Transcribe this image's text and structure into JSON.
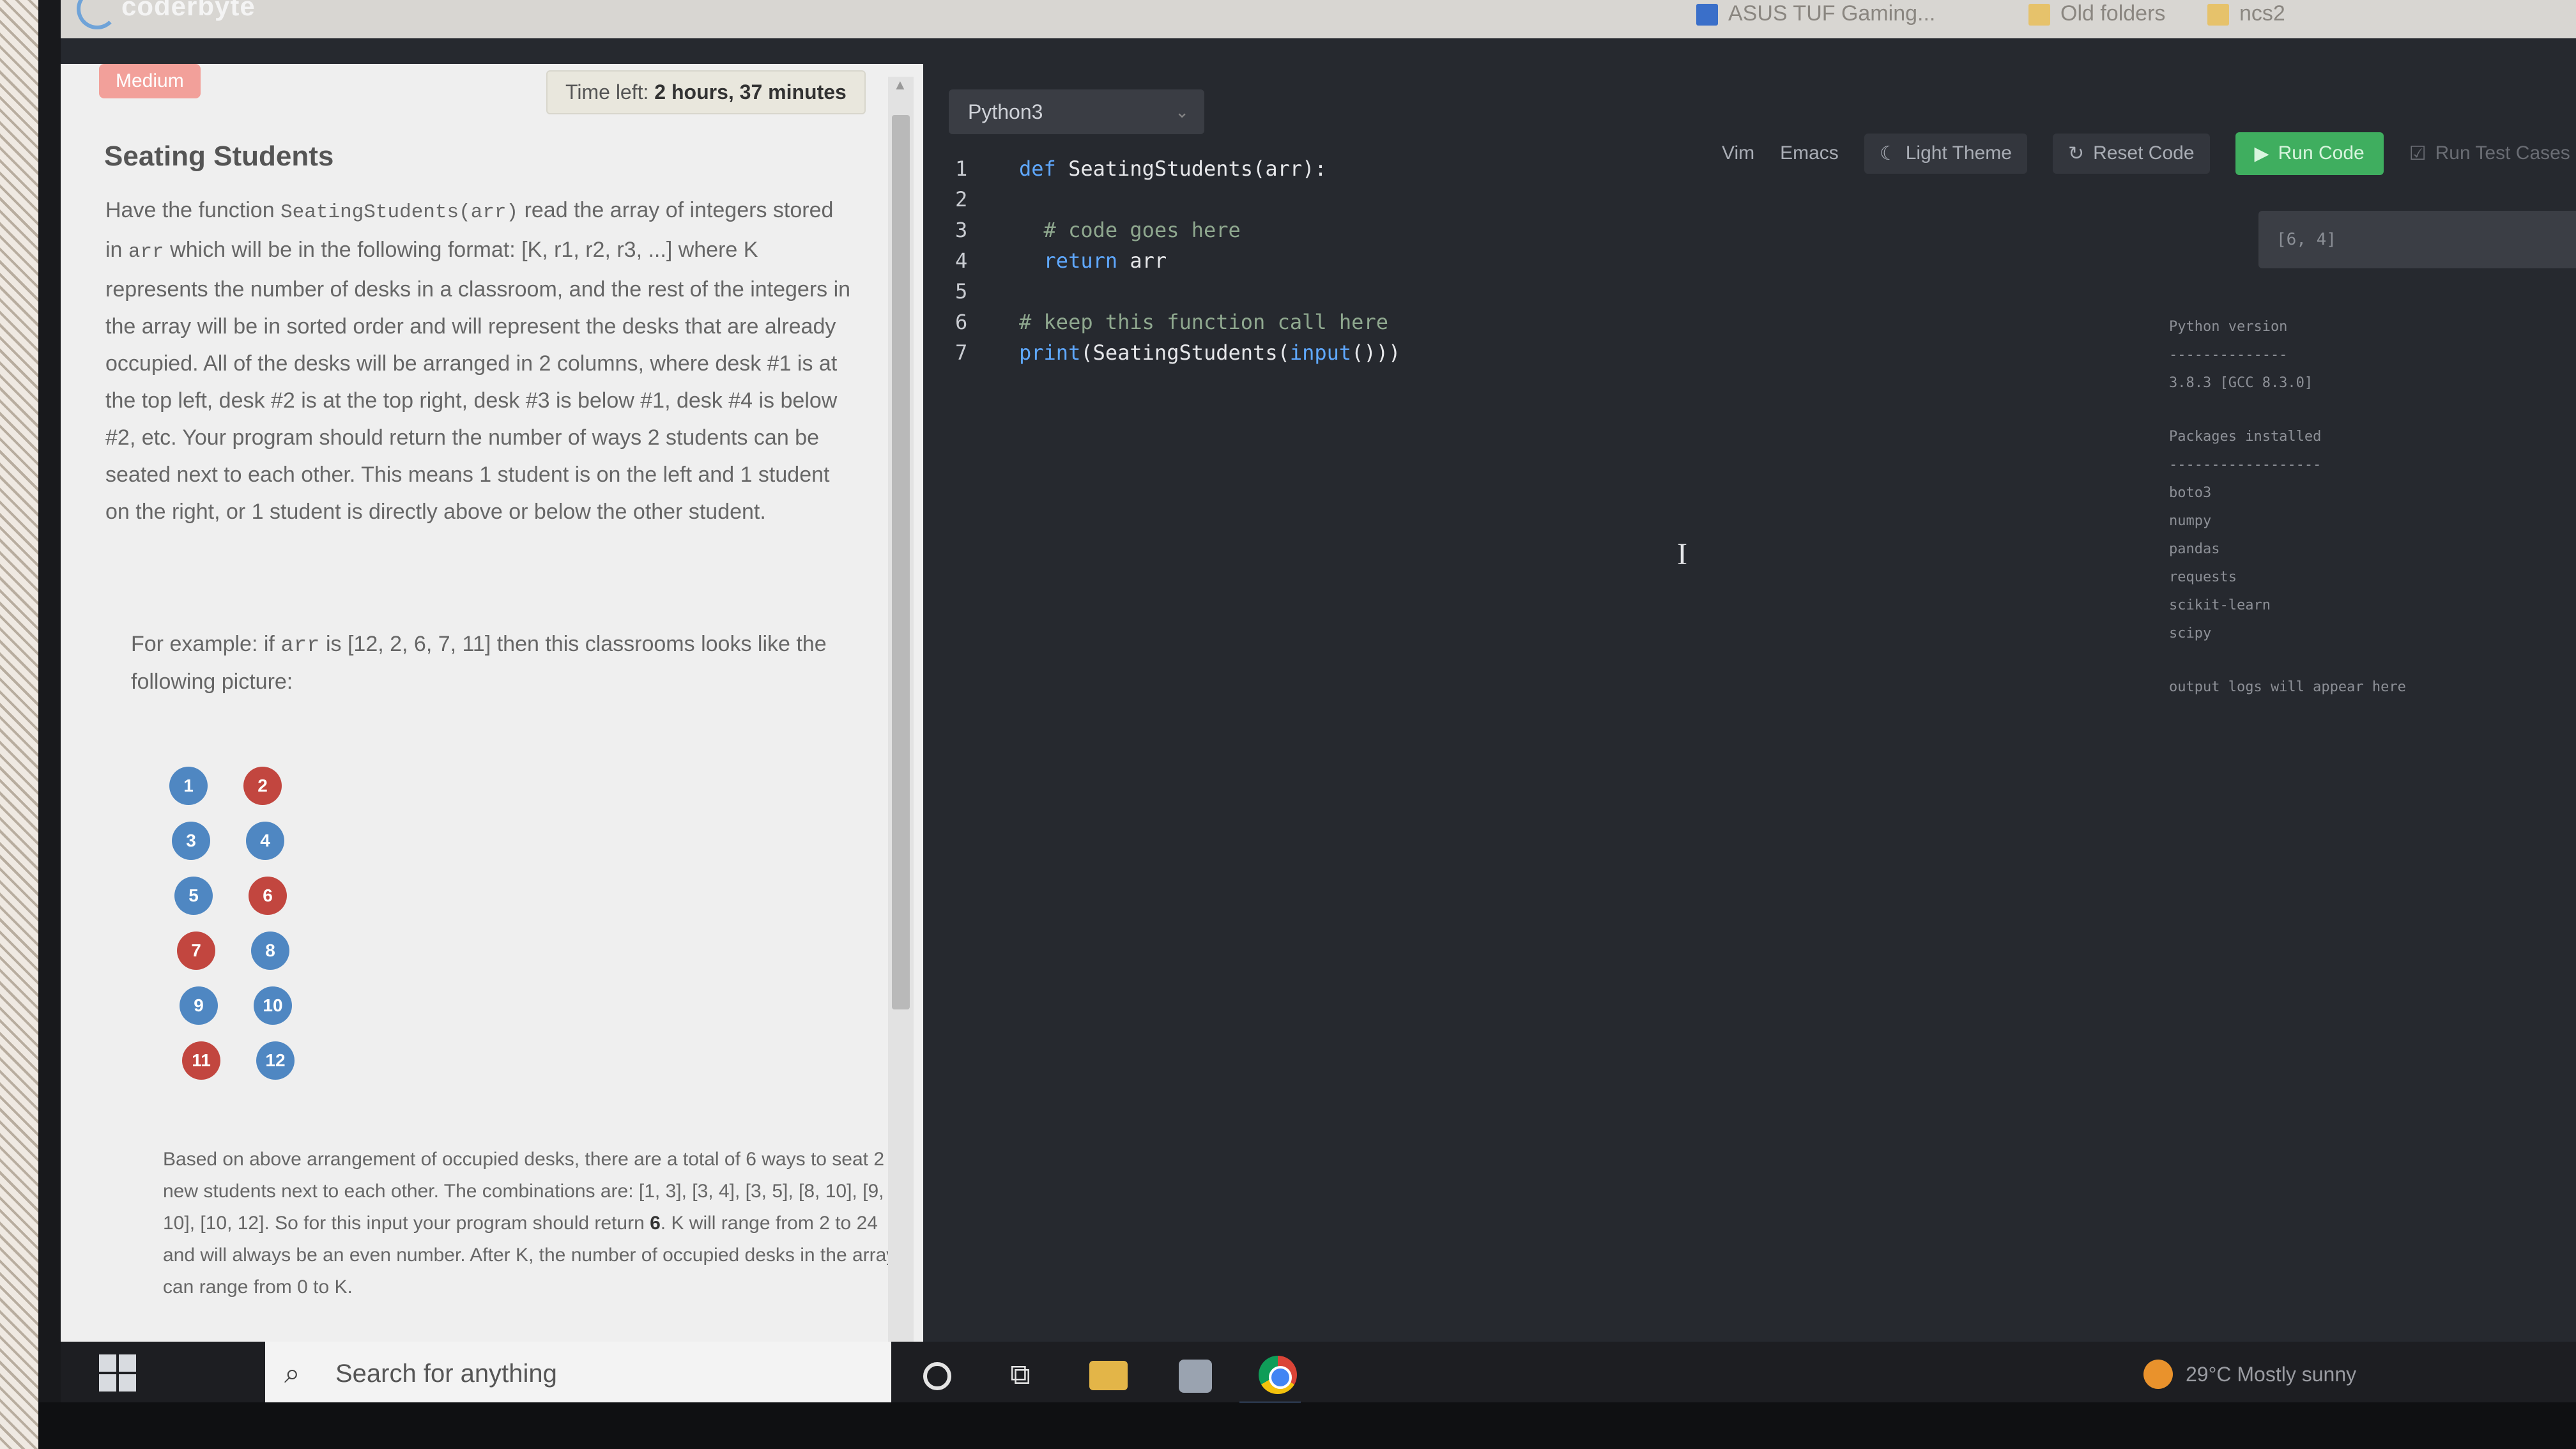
{
  "browser": {
    "brand": "coderbyte",
    "bookmarks": [
      "ASUS TUF Gaming...",
      "Old folders",
      "ncs2"
    ]
  },
  "problem": {
    "difficulty": "Medium",
    "timer_prefix": "Time left:",
    "timer_value": "2 hours, 37 minutes",
    "title": "Seating Students",
    "desc_1": "Have the function ",
    "desc_fn": "SeatingStudents(arr)",
    "desc_2": " read the array of integers stored in ",
    "desc_arr": "arr",
    "desc_3": " which will be in the following format: [K, r1, r2, r3, ...] where K represents the number of desks in a classroom, and the rest of the integers in the array will be in sorted order and will represent the desks that are already occupied. All of the desks will be arranged in 2 columns, where desk #1 is at the top left, desk #2 is at the top right, desk #3 is below #1, desk #4 is below #2, etc. Your program should return the number of ways 2 students can be seated next to each other. This means 1 student is on the left and 1 student on the right, or 1 student is directly above or below the other student.",
    "example_1": "For example: if ",
    "example_arr": "arr",
    "example_2": " is [12, 2, 6, 7, 11] then this classrooms looks like the following picture:",
    "seats": [
      {
        "n": "1",
        "status": "free"
      },
      {
        "n": "2",
        "status": "taken"
      },
      {
        "n": "3",
        "status": "free"
      },
      {
        "n": "4",
        "status": "free"
      },
      {
        "n": "5",
        "status": "free"
      },
      {
        "n": "6",
        "status": "taken"
      },
      {
        "n": "7",
        "status": "taken"
      },
      {
        "n": "8",
        "status": "free"
      },
      {
        "n": "9",
        "status": "free"
      },
      {
        "n": "10",
        "status": "free"
      },
      {
        "n": "11",
        "status": "taken"
      },
      {
        "n": "12",
        "status": "free"
      }
    ],
    "footnote_1": "Based on above arrangement of occupied desks, there are a total of 6 ways to seat 2 new students next to each other. The combinations are: [1, 3], [3, 4], [3, 5], [8, 10], [9, 10], [10, 12]. So for this input your program should return ",
    "footnote_bold": "6",
    "footnote_2": ". K will range from 2 to 24 and will always be an even number. After K, the number of occupied desks in the array can range from 0 to K."
  },
  "editor": {
    "language": "Python3",
    "toolbar": {
      "vim": "Vim",
      "emacs": "Emacs",
      "theme": "Light Theme",
      "reset": "Reset Code",
      "run": "Run Code",
      "run_tests": "Run Test Cases"
    },
    "lines": [
      {
        "n": "1",
        "indent": "",
        "parts": [
          {
            "t": "def",
            "c": "kw"
          },
          {
            "t": " SeatingStudents(arr):",
            "c": "tx"
          }
        ]
      },
      {
        "n": "2",
        "indent": "",
        "parts": []
      },
      {
        "n": "3",
        "indent": "  ",
        "parts": [
          {
            "t": "# code goes here",
            "c": "cm"
          }
        ]
      },
      {
        "n": "4",
        "indent": "  ",
        "parts": [
          {
            "t": "return",
            "c": "kw"
          },
          {
            "t": " arr",
            "c": "tx"
          }
        ]
      },
      {
        "n": "5",
        "indent": "",
        "parts": []
      },
      {
        "n": "6",
        "indent": "",
        "parts": [
          {
            "t": "# keep this function call here",
            "c": "cm"
          }
        ]
      },
      {
        "n": "7",
        "indent": "",
        "parts": [
          {
            "t": "print",
            "c": "kw"
          },
          {
            "t": "(SeatingStudents(",
            "c": "tx"
          },
          {
            "t": "input",
            "c": "kw"
          },
          {
            "t": "()))",
            "c": "tx"
          }
        ]
      }
    ],
    "test_input": "[6, 4]",
    "env": {
      "python_heading": "Python version",
      "divider_1": "--------------",
      "python_version": "3.8.3 [GCC 8.3.0]",
      "packages_heading": "Packages installed",
      "divider_2": "------------------",
      "packages": [
        "boto3",
        "numpy",
        "pandas",
        "requests",
        "scikit-learn",
        "scipy"
      ],
      "output_hint": "output logs will appear here"
    }
  },
  "taskbar": {
    "search_placeholder": "Search for anything",
    "weather": "29°C  Mostly sunny"
  }
}
